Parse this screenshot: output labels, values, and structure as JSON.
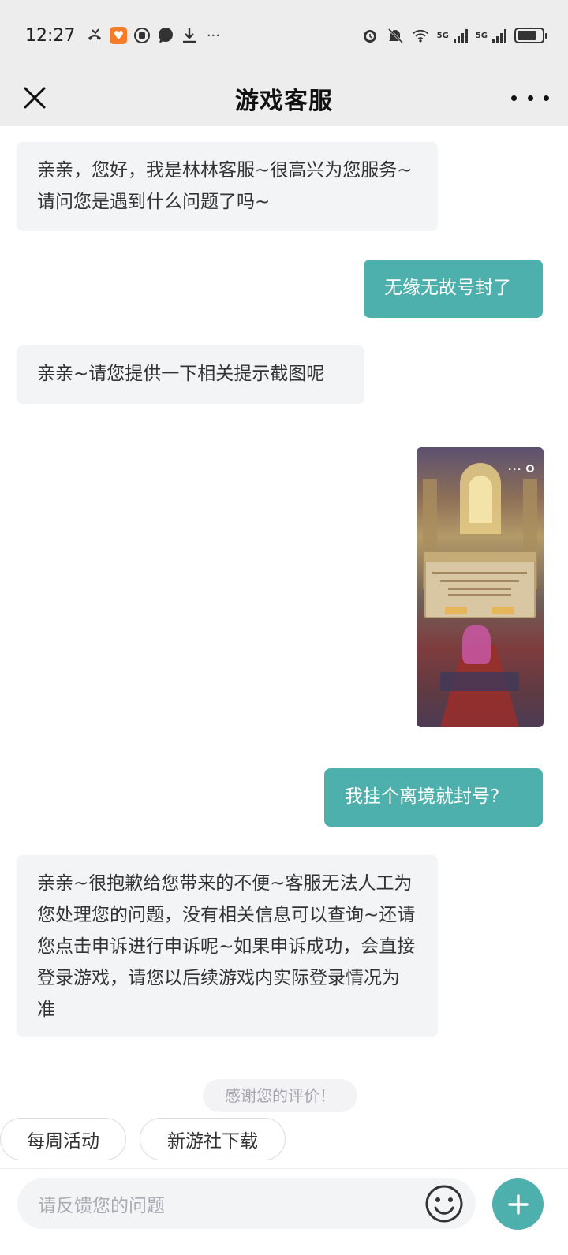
{
  "status_bar": {
    "time": "12:27",
    "left_icons": [
      "missed-call-icon",
      "brand-app-icon",
      "hand-icon",
      "chat-bubble-icon",
      "download-icon",
      "more-dots-icon"
    ],
    "more_label": "···",
    "right_icons": [
      "alarm-icon",
      "mute-bell-icon",
      "wifi-icon",
      "signal-5g-icon",
      "signal-5g-icon",
      "battery-icon"
    ],
    "network_label": "5G"
  },
  "nav": {
    "title": "游戏客服"
  },
  "messages": [
    {
      "side": "in",
      "text": "亲亲，您好，我是林林客服~很高兴为您服务~请问您是遇到什么问题了吗~"
    },
    {
      "side": "out",
      "text": "无缘无故号封了"
    },
    {
      "side": "in",
      "text": "亲亲~请您提供一下相关提示截图呢"
    },
    {
      "side": "out",
      "type": "image",
      "alt": "game-screenshot"
    },
    {
      "side": "out",
      "text": "我挂个离境就封号?"
    },
    {
      "side": "in",
      "text": "亲亲~很抱歉给您带来的不便~客服无法人工为您处理您的问题，没有相关信息可以查询~还请您点击申诉进行申诉呢~如果申诉成功，会直接登录游戏，请您以后续游戏内实际登录情况为准"
    }
  ],
  "rating_notice": "感谢您的评价！",
  "quick_replies": [
    "每周活动",
    "新游社下载"
  ],
  "input": {
    "placeholder": "请反馈您的问题"
  },
  "colors": {
    "accent": "#4eb0ad",
    "bubble_in": "#f3f4f6",
    "header_bg": "#ededed"
  }
}
